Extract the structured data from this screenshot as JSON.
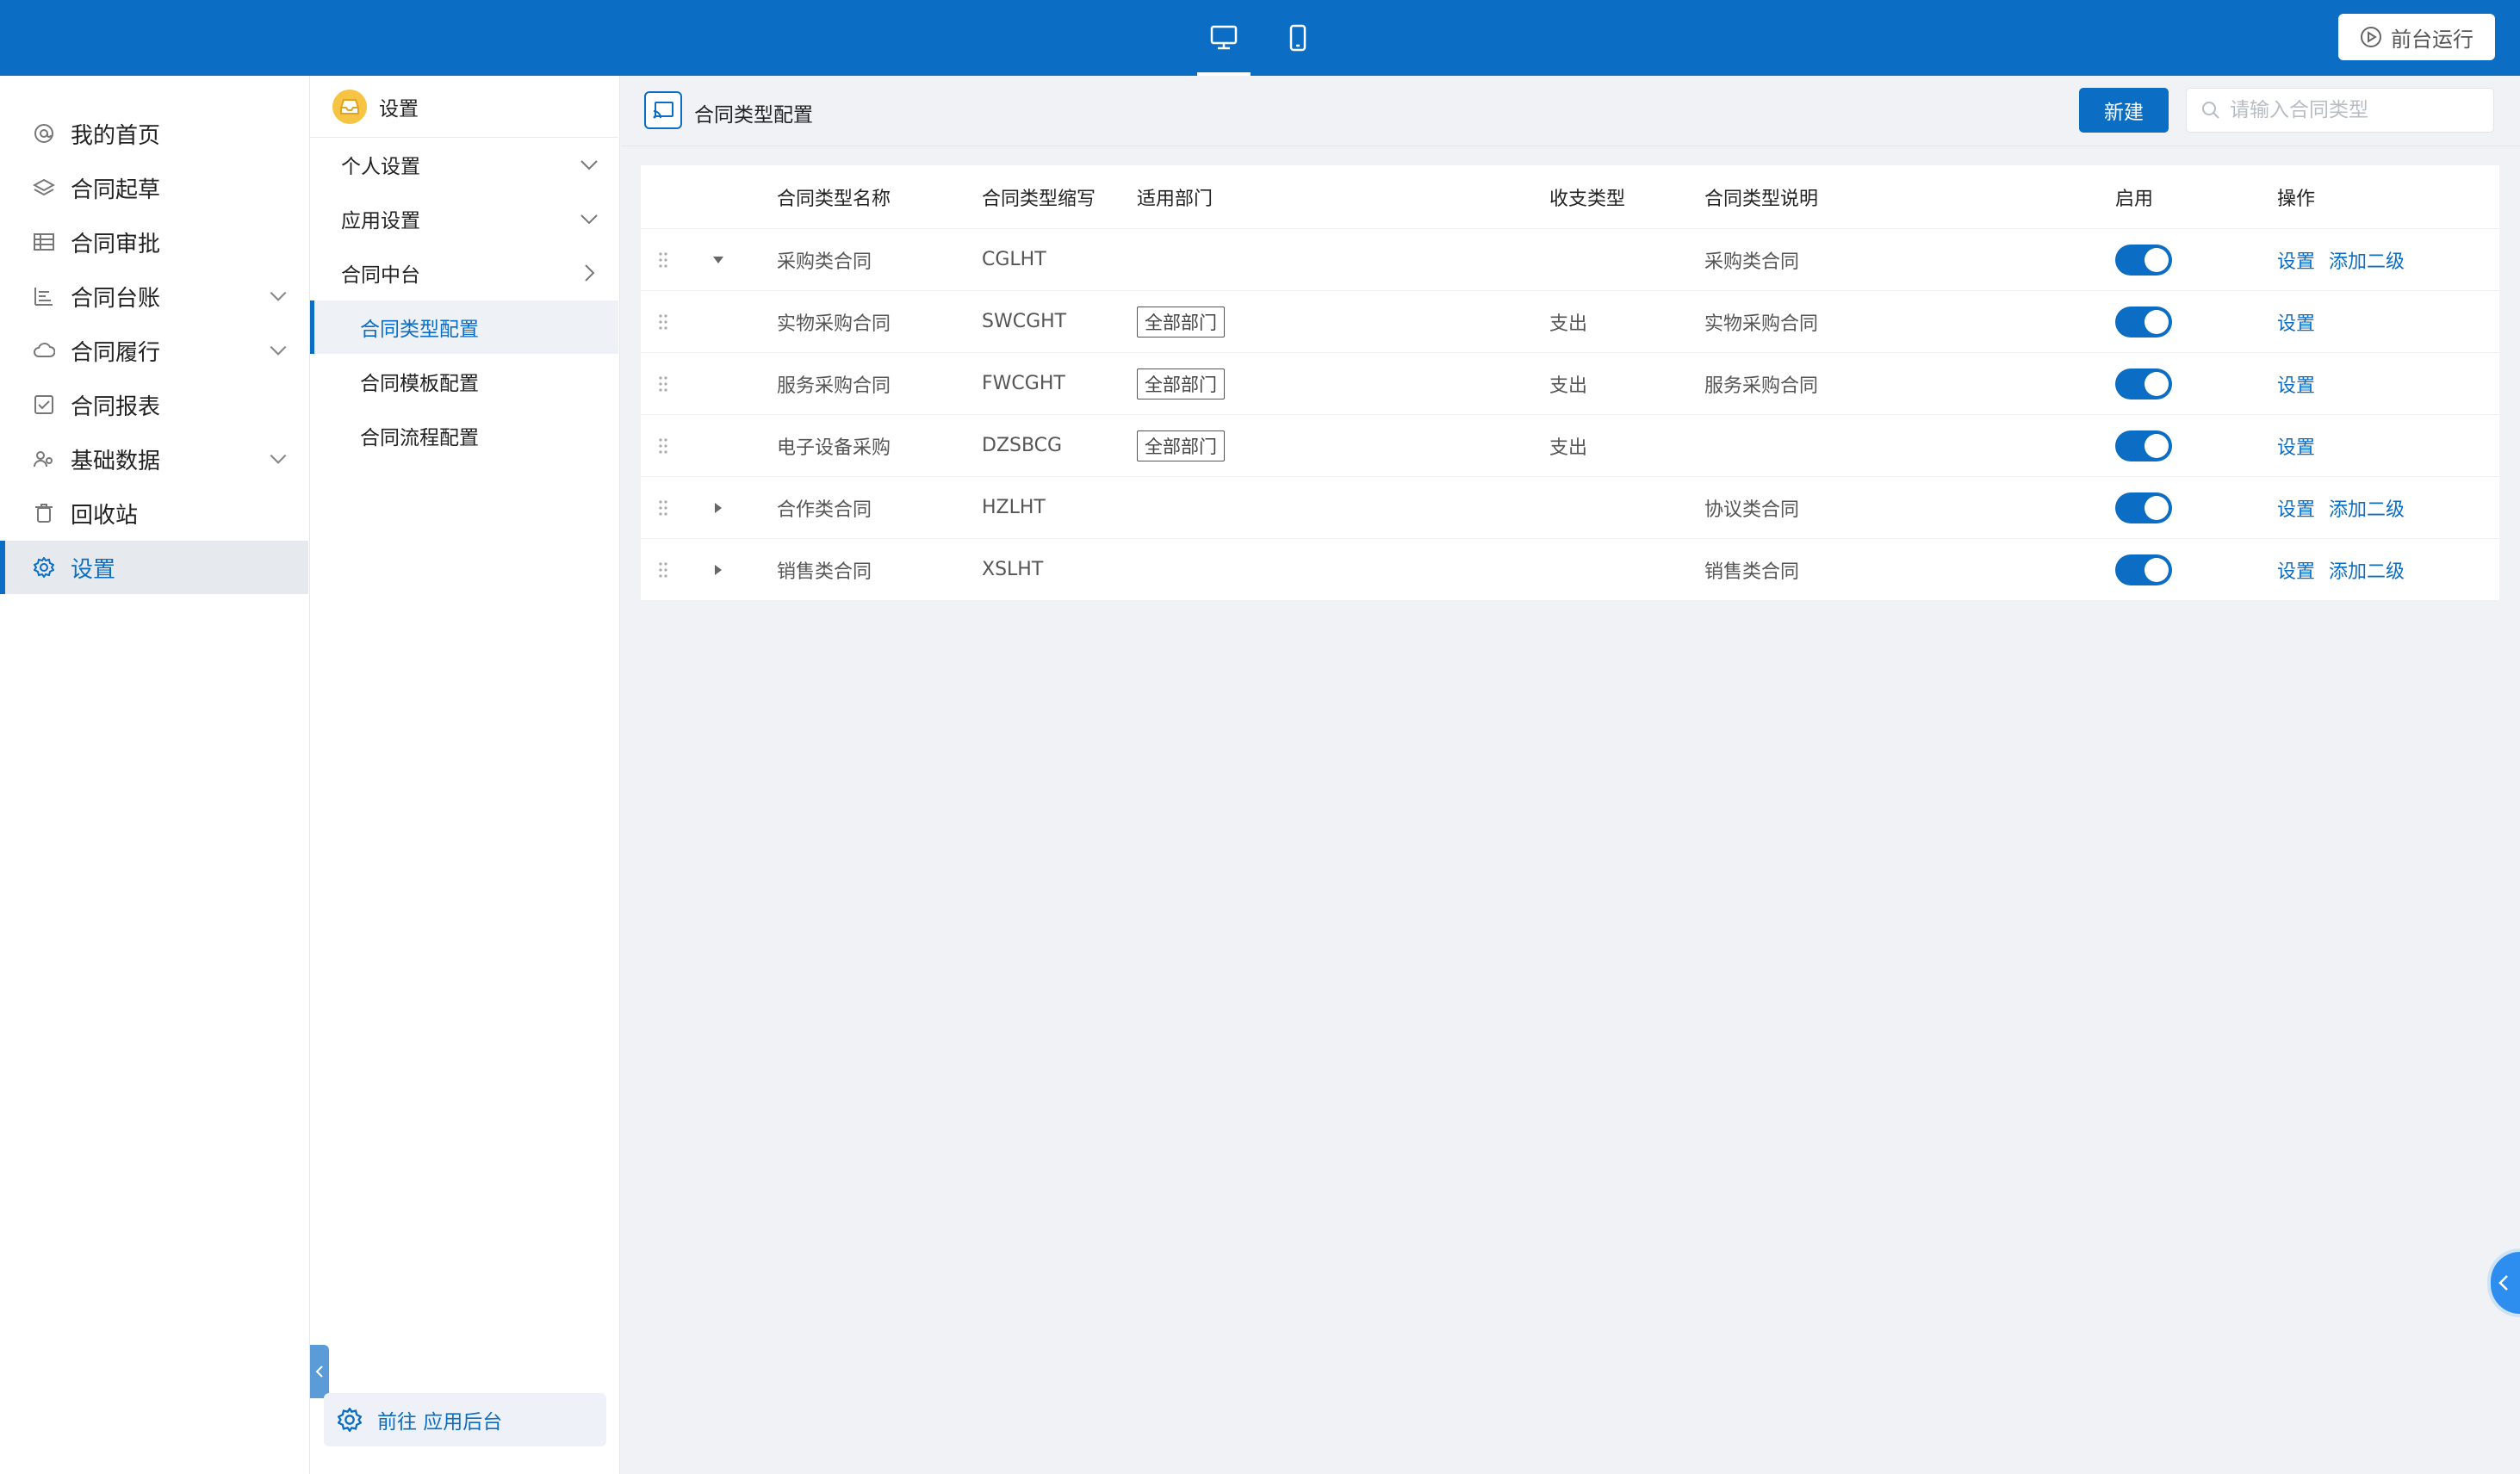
{
  "topbar": {
    "devices": [
      "desktop-icon",
      "mobile-icon"
    ],
    "active_device": "desktop",
    "run_label": "前台运行"
  },
  "leftnav": {
    "items": [
      {
        "label": "我的首页",
        "icon": "at-icon",
        "expandable": false
      },
      {
        "label": "合同起草",
        "icon": "layers-icon",
        "expandable": false
      },
      {
        "label": "合同审批",
        "icon": "table-icon",
        "expandable": false
      },
      {
        "label": "合同台账",
        "icon": "bars-icon",
        "expandable": true
      },
      {
        "label": "合同履行",
        "icon": "cloud-icon",
        "expandable": true
      },
      {
        "label": "合同报表",
        "icon": "checkbox-icon",
        "expandable": false
      },
      {
        "label": "基础数据",
        "icon": "people-icon",
        "expandable": true
      },
      {
        "label": "回收站",
        "icon": "trash-icon",
        "expandable": false
      },
      {
        "label": "设置",
        "icon": "gear-icon",
        "expandable": false,
        "active": true
      }
    ]
  },
  "subnav": {
    "title": "设置",
    "items": [
      {
        "label": "个人设置",
        "chevron": "down"
      },
      {
        "label": "应用设置",
        "chevron": "down"
      },
      {
        "label": "合同中台",
        "chevron": "right"
      },
      {
        "label": "合同类型配置",
        "child": true,
        "active": true
      },
      {
        "label": "合同模板配置",
        "child": true
      },
      {
        "label": "合同流程配置",
        "child": true
      }
    ],
    "goto_label": "前往 应用后台"
  },
  "main": {
    "title": "合同类型配置",
    "new_label": "新建",
    "search_placeholder": "请输入合同类型"
  },
  "table": {
    "columns": [
      "合同类型名称",
      "合同类型缩写",
      "适用部门",
      "收支类型",
      "合同类型说明",
      "启用",
      "操作"
    ],
    "rows": [
      {
        "name": "采购类合同",
        "abbr": "CGLHT",
        "dept": "",
        "io": "",
        "desc": "采购类合同",
        "enabled": true,
        "expand": "expanded",
        "actions": [
          "设置",
          "添加二级"
        ]
      },
      {
        "name": "实物采购合同",
        "abbr": "SWCGHT",
        "dept": "全部部门",
        "io": "支出",
        "desc": "实物采购合同",
        "enabled": true,
        "expand": "none",
        "actions": [
          "设置"
        ]
      },
      {
        "name": "服务采购合同",
        "abbr": "FWCGHT",
        "dept": "全部部门",
        "io": "支出",
        "desc": "服务采购合同",
        "enabled": true,
        "expand": "none",
        "actions": [
          "设置"
        ]
      },
      {
        "name": "电子设备采购",
        "abbr": "DZSBCG",
        "dept": "全部部门",
        "io": "支出",
        "desc": "",
        "enabled": true,
        "expand": "none",
        "actions": [
          "设置"
        ]
      },
      {
        "name": "合作类合同",
        "abbr": "HZLHT",
        "dept": "",
        "io": "",
        "desc": "协议类合同",
        "enabled": true,
        "expand": "collapsed",
        "actions": [
          "设置",
          "添加二级"
        ]
      },
      {
        "name": "销售类合同",
        "abbr": "XSLHT",
        "dept": "",
        "io": "",
        "desc": "销售类合同",
        "enabled": true,
        "expand": "collapsed",
        "actions": [
          "设置",
          "添加二级"
        ]
      }
    ]
  },
  "colors": {
    "primary": "#0b6dc3",
    "background": "#f0f2f5"
  }
}
